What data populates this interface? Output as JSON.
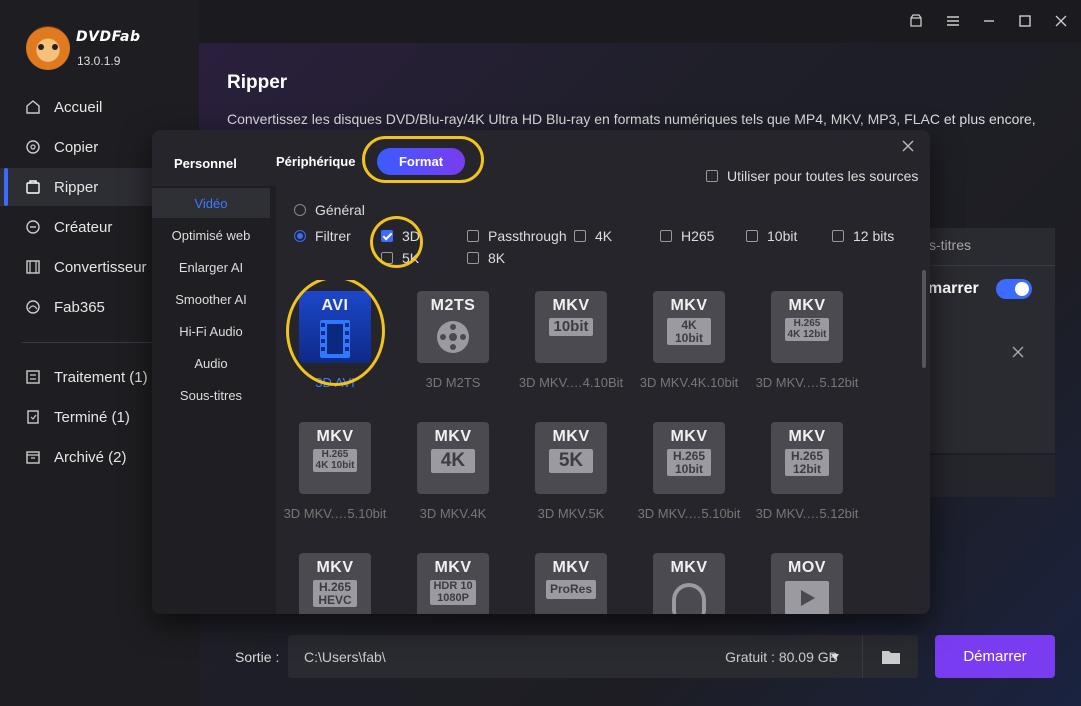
{
  "app": {
    "brand": "DVDFab",
    "version": "13.0.1.9"
  },
  "sidebar": {
    "items": [
      {
        "label": "Accueil",
        "icon": "home-icon"
      },
      {
        "label": "Copier",
        "icon": "copy-icon"
      },
      {
        "label": "Ripper",
        "icon": "ripper-icon"
      },
      {
        "label": "Créateur",
        "icon": "creator-icon"
      },
      {
        "label": "Convertisseur",
        "icon": "converter-icon"
      },
      {
        "label": "Fab365",
        "icon": "fab365-icon"
      }
    ],
    "queue": [
      {
        "label": "Traitement (1)",
        "icon": "processing-icon"
      },
      {
        "label": "Terminé (1)",
        "icon": "done-icon"
      },
      {
        "label": "Archivé (2)",
        "icon": "archive-icon"
      }
    ]
  },
  "main": {
    "title": "Ripper",
    "description": "Convertissez les disques DVD/Blu-ray/4K Ultra HD Blu-ray en formats numériques tels que MP4, MKV, MP3, FLAC et plus encore,",
    "behind_tab": "s-titres",
    "behind_label": "marrer",
    "output_label": "Sortie :",
    "output_path": "C:\\Users\\fab\\",
    "free_space": "Gratuit : 80.09 GB",
    "start_label": "Démarrer"
  },
  "modal": {
    "personnel": "Personnel",
    "tabs": [
      "Périphérique",
      "Format"
    ],
    "active_tab": "Format",
    "use_all_label": "Utiliser pour toutes les sources",
    "categories": [
      "Vidéo",
      "Optimisé web",
      "Enlarger AI",
      "Smoother AI",
      "Hi-Fi Audio",
      "Audio",
      "Sous-titres"
    ],
    "active_category": "Vidéo",
    "radio": [
      {
        "label": "Général",
        "checked": false
      },
      {
        "label": "Filtrer",
        "checked": true
      }
    ],
    "filters": [
      {
        "label": "3D",
        "checked": true
      },
      {
        "label": "5K",
        "checked": false
      },
      {
        "label": "Passthrough",
        "checked": false
      },
      {
        "label": "8K",
        "checked": false
      },
      {
        "label": "4K",
        "checked": false
      },
      {
        "label": "H265",
        "checked": false
      },
      {
        "label": "10bit",
        "checked": false
      },
      {
        "label": "12 bits",
        "checked": false
      }
    ],
    "formats": [
      {
        "title": "AVI",
        "sub": "",
        "caption": "3D AVI",
        "selected": true
      },
      {
        "title": "M2TS",
        "sub": "",
        "caption": "3D M2TS"
      },
      {
        "title": "MKV",
        "sub": "10bit",
        "caption": "3D MKV.…4.10Bit"
      },
      {
        "title": "MKV",
        "sub": "4K\n10bit",
        "caption": "3D MKV.4K.10bit"
      },
      {
        "title": "MKV",
        "sub": "H.265\n4K 12bit",
        "caption": "3D MKV.…5.12bit"
      },
      {
        "title": "MKV",
        "sub": "H.265\n4K 10bit",
        "caption": "3D MKV.…5.10bit"
      },
      {
        "title": "MKV",
        "sub": "4K",
        "caption": "3D MKV.4K"
      },
      {
        "title": "MKV",
        "sub": "5K",
        "caption": "3D MKV.5K"
      },
      {
        "title": "MKV",
        "sub": "H.265\n10bit",
        "caption": "3D MKV.…5.10bit"
      },
      {
        "title": "MKV",
        "sub": "H.265\n12bit",
        "caption": "3D MKV.…5.12bit"
      },
      {
        "title": "MKV",
        "sub": "H.265\nHEVC",
        "caption": ""
      },
      {
        "title": "MKV",
        "sub": "HDR 10\n1080P",
        "caption": ""
      },
      {
        "title": "MKV",
        "sub": "ProRes",
        "caption": ""
      },
      {
        "title": "MKV",
        "sub": "",
        "caption": ""
      },
      {
        "title": "MOV",
        "sub": "",
        "caption": ""
      }
    ]
  },
  "colors": {
    "accent": "#3b6cff",
    "highlight": "#f2c21d",
    "start": "#7a3cf0"
  }
}
